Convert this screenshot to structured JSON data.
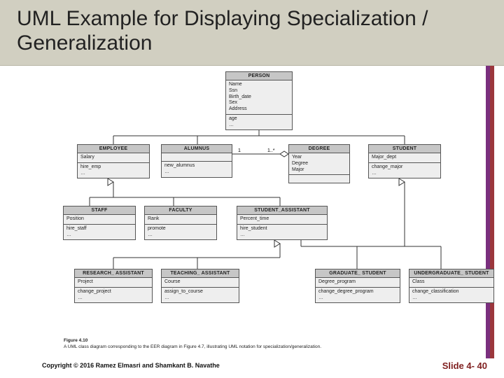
{
  "title": "UML Example for Displaying Specialization / Generalization",
  "footer": {
    "copyright": "Copyright © 2016 Ramez Elmasri and Shamkant B. Navathe",
    "slide_label": "Slide 4- 40"
  },
  "caption": {
    "figno": "Figure 4.10",
    "text": "A UML class diagram corresponding to the EER diagram in Figure 4.7, illustrating UML notation for specialization/generalization."
  },
  "classes": {
    "person": {
      "name": "PERSON",
      "attrs": [
        "Name",
        "Ssn",
        "Birth_date",
        "Sex",
        "Address"
      ],
      "ops": [
        "age",
        "…"
      ]
    },
    "employee": {
      "name": "EMPLOYEE",
      "attrs": [
        "Salary"
      ],
      "ops": [
        "hire_emp",
        "…"
      ]
    },
    "alumnus": {
      "name": "ALUMNUS",
      "attrs": [],
      "ops": [
        "new_alumnus",
        "…"
      ]
    },
    "degree": {
      "name": "DEGREE",
      "attrs": [
        "Year",
        "Degree",
        "Major"
      ],
      "ops": []
    },
    "student": {
      "name": "STUDENT",
      "attrs": [
        "Major_dept"
      ],
      "ops": [
        "change_major",
        "…"
      ]
    },
    "staff": {
      "name": "STAFF",
      "attrs": [
        "Position"
      ],
      "ops": [
        "hire_staff",
        "…"
      ]
    },
    "faculty": {
      "name": "FACULTY",
      "attrs": [
        "Rank"
      ],
      "ops": [
        "promote",
        "…"
      ]
    },
    "stuast": {
      "name": "STUDENT_ASSISTANT",
      "attrs": [
        "Percent_time"
      ],
      "ops": [
        "hire_student",
        "…"
      ]
    },
    "resast": {
      "name": "RESEARCH_ ASSISTANT",
      "attrs": [
        "Project"
      ],
      "ops": [
        "change_project",
        "…"
      ]
    },
    "teachast": {
      "name": "TEACHING_ ASSISTANT",
      "attrs": [
        "Course"
      ],
      "ops": [
        "assign_to_course",
        "…"
      ]
    },
    "grad": {
      "name": "GRADUATE_ STUDENT",
      "attrs": [
        "Degree_program"
      ],
      "ops": [
        "change_degree_program",
        "…"
      ]
    },
    "ugrad": {
      "name": "UNDERGRADUATE_ STUDENT",
      "attrs": [
        "Class"
      ],
      "ops": [
        "change_classification",
        "…"
      ]
    }
  },
  "assoc_mults": {
    "alumnus_side": "1",
    "degree_side": "1..*"
  }
}
